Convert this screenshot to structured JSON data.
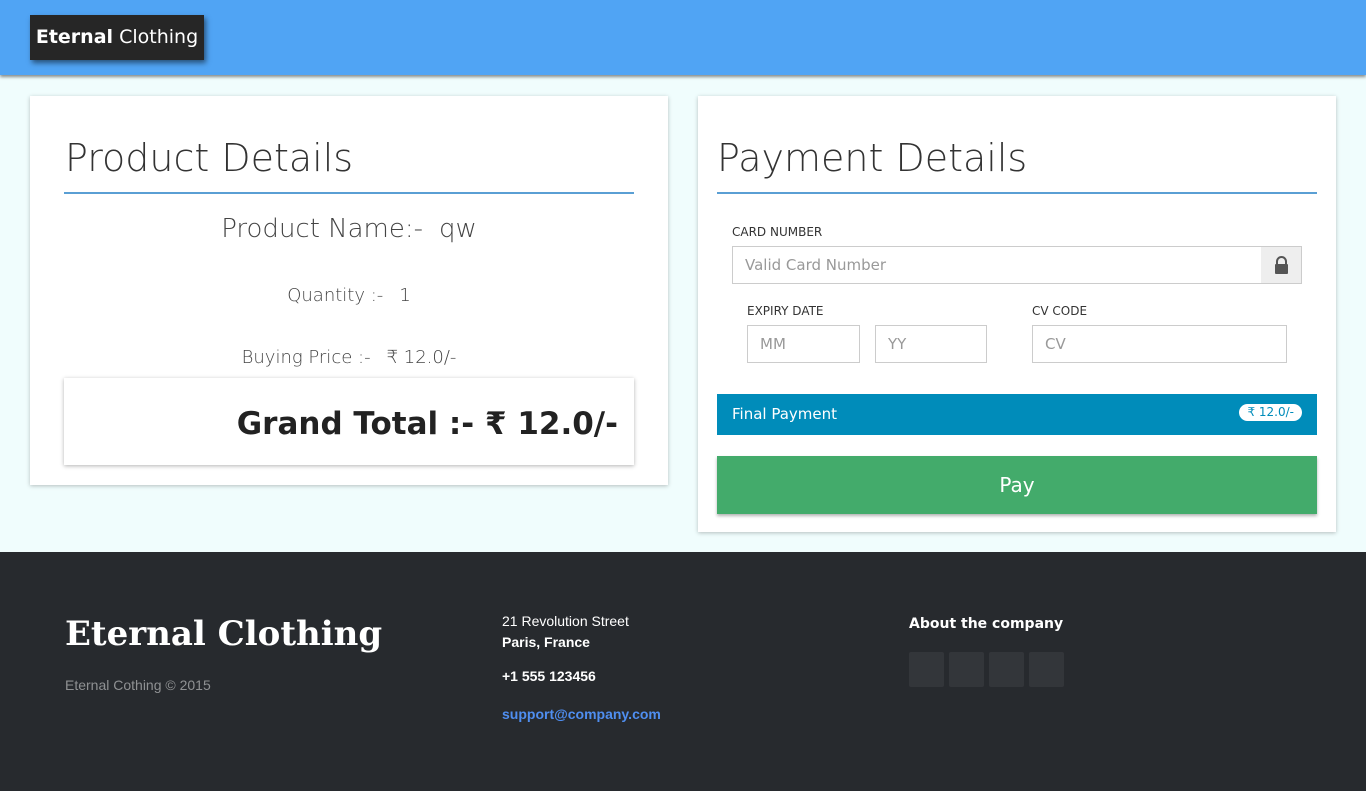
{
  "header": {
    "brand_bold": "Eternal",
    "brand_rest": "Clothing",
    "brand_color": "#50a4f4"
  },
  "product": {
    "title": "Product Details",
    "name_label": "Product Name:-",
    "name_value": "qw",
    "quantity_label": "Quantity :-",
    "quantity_value": "1",
    "price_label": "Buying Price :-",
    "price_value": "₹ 12.0/-",
    "grand_total": "Grand Total :- ₹ 12.0/-"
  },
  "payment": {
    "title": "Payment Details",
    "card_number_label": "CARD NUMBER",
    "card_number_placeholder": "Valid Card Number",
    "expiry_label": "EXPIRY DATE",
    "month_placeholder": "MM",
    "year_placeholder": "YY",
    "cv_label": "CV CODE",
    "cv_placeholder": "CV",
    "final_label": "Final Payment",
    "final_amount": "₹ 12.0/-",
    "pay_label": "Pay",
    "final_bar_color": "#008cba",
    "pay_color": "#43ab6b"
  },
  "footer": {
    "logo": "Eternal Clothing",
    "copyright": "Eternal Cothing © 2015",
    "address_line1": "21 Revolution Street",
    "address_line2": "Paris, France",
    "phone": "+1 555 123456",
    "email": "support@company.com",
    "about_title": "About the company",
    "social_icons": [
      "social-icon",
      "social-icon",
      "social-icon",
      "social-icon"
    ]
  }
}
